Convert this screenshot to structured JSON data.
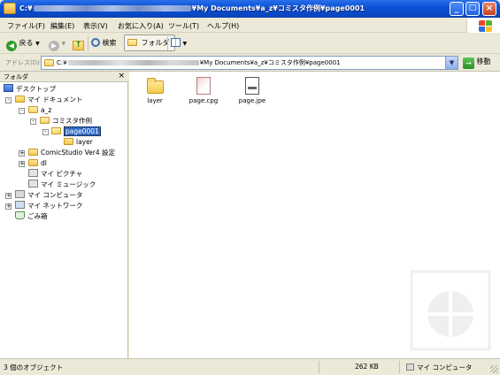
{
  "window": {
    "title_prefix": "C:¥",
    "title_suffix": "¥My Documents¥a_z¥コミスタ作例¥page0001",
    "buttons": {
      "minimize": "_",
      "maximize": "□",
      "close": "×"
    }
  },
  "menu": {
    "items": [
      {
        "label": "ファイル(F)"
      },
      {
        "label": "編集(E)"
      },
      {
        "label": "表示(V)"
      },
      {
        "label": "お気に入り(A)"
      },
      {
        "label": "ツール(T)"
      },
      {
        "label": "ヘルプ(H)"
      }
    ]
  },
  "toolbar": {
    "back_label": "戻る",
    "search_label": "検索",
    "folders_label": "フォルダ"
  },
  "address": {
    "label": "アドレス(D)",
    "path_prefix": "C:¥",
    "path_suffix": "¥My Documents¥a_z¥コミスタ作例¥page0001",
    "go_label": "移動"
  },
  "folder_pane": {
    "title": "フォルダ",
    "close": "×",
    "tree": [
      {
        "label": "デスクトップ"
      },
      {
        "label": "マイ ドキュメント"
      },
      {
        "label": "a_z"
      },
      {
        "label": "コミスタ作例"
      },
      {
        "label": "page0001"
      },
      {
        "label": "layer"
      },
      {
        "label": "ComicStudio Ver4 設定"
      },
      {
        "label": "dl"
      },
      {
        "label": "マイ ピクチャ"
      },
      {
        "label": "マイ ミュージック"
      },
      {
        "label": "マイ コンピュータ"
      },
      {
        "label": "マイ ネットワーク"
      },
      {
        "label": "ごみ箱"
      }
    ]
  },
  "files": [
    {
      "name": "layer",
      "icon": "folder-icon"
    },
    {
      "name": "page.cpg",
      "icon": "cpg-file-icon"
    },
    {
      "name": "page.jpe",
      "icon": "jpeg-file-icon"
    }
  ],
  "status": {
    "objects": "3 個のオブジェクト",
    "size": "262 KB",
    "location": "マイ コンピュータ"
  },
  "colors": {
    "titlebar": "#0B52D6",
    "selection": "#316AC5",
    "chrome": "#ECE9D8"
  }
}
